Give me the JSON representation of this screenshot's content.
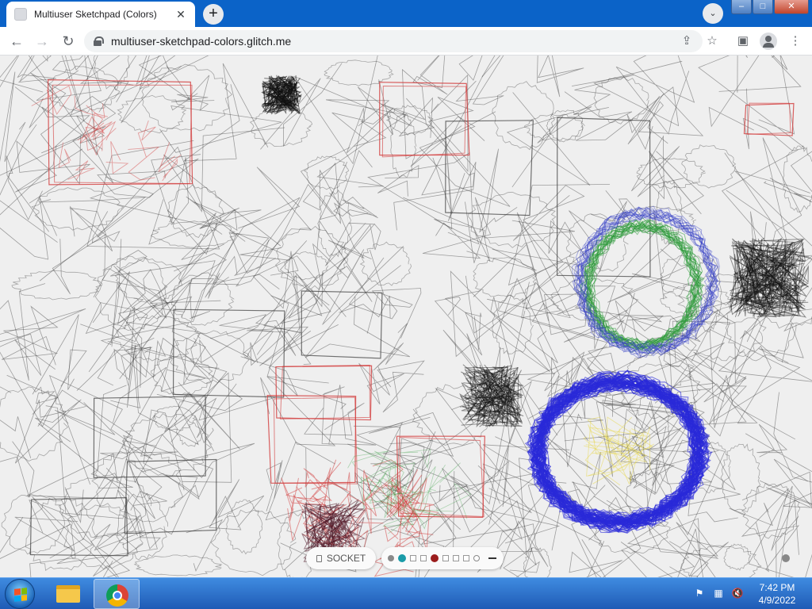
{
  "browser": {
    "tab_title": "Multiuser Sketchpad (Colors)",
    "tab_close": "✕",
    "new_tab": "+",
    "tab_search": "⌄",
    "url": "multiuser-sketchpad-colors.glitch.me",
    "nav_icons": {
      "back": "←",
      "forward": "→",
      "reload": "↻"
    },
    "toolbar_icons": {
      "share": "⇪",
      "bookmark": "☆",
      "side_panel": "▣",
      "menu": "⋮"
    },
    "window_controls": {
      "minimize": "–",
      "maximize": "□",
      "close": "✕"
    }
  },
  "sketchpad": {
    "connection_label": "SOCKET",
    "palette": [
      {
        "kind": "dot",
        "color": "#8a8a8a"
      },
      {
        "kind": "dot",
        "color": "#1a9ba8",
        "selected": true
      },
      {
        "kind": "square",
        "color": "#ffffff"
      },
      {
        "kind": "square",
        "color": "#ffffff"
      },
      {
        "kind": "dot",
        "color": "#9b1c1c",
        "selected": true
      },
      {
        "kind": "square",
        "color": "#ffffff"
      },
      {
        "kind": "square",
        "color": "#ffffff"
      },
      {
        "kind": "square",
        "color": "#ffffff"
      },
      {
        "kind": "ring",
        "color": "#ffffff"
      },
      {
        "kind": "bar",
        "color": "#333333"
      }
    ]
  },
  "taskbar": {
    "time": "7:42 PM",
    "date": "4/9/2022",
    "tray_icons": [
      "action-center-flag-icon",
      "network-icon",
      "volume-muted-icon"
    ]
  },
  "colors": {
    "titlebar": "#0b63c8",
    "taskbar": "#2a6cc8",
    "canvas_bg": "#efefef",
    "scribble_gray": "#3a3a3a",
    "scribble_red": "#d23a3a",
    "scribble_blue": "#2a2ad8",
    "scribble_green": "#2e9a3a"
  }
}
